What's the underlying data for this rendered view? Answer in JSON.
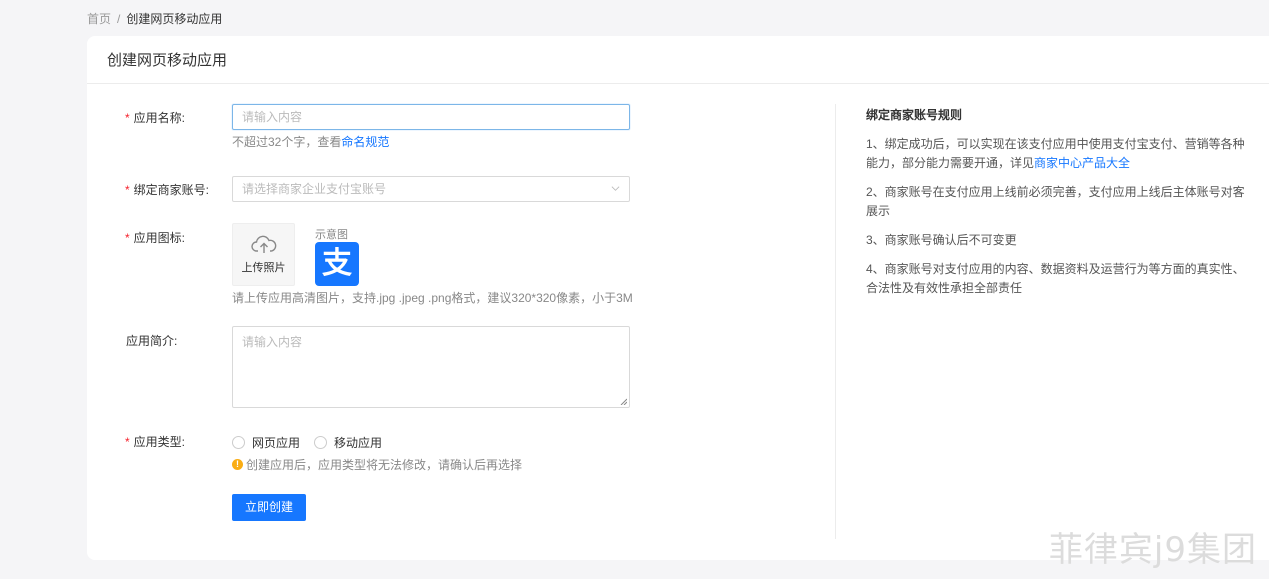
{
  "breadcrumb": {
    "home": "首页",
    "separator": "/",
    "current": "创建网页移动应用"
  },
  "card": {
    "title": "创建网页移动应用"
  },
  "form": {
    "app_name": {
      "label": "应用名称:",
      "placeholder": "请输入内容",
      "help_prefix": "不超过32个字，查看",
      "help_link": "命名规范"
    },
    "merchant": {
      "label": "绑定商家账号:",
      "placeholder": "请选择商家企业支付宝账号"
    },
    "icon": {
      "label": "应用图标:",
      "upload_text": "上传照片",
      "sample_label": "示意图",
      "sample_glyph": "支",
      "help": "请上传应用高清图片，支持.jpg .jpeg .png格式，建议320*320像素，小于3M"
    },
    "intro": {
      "label": "应用简介:",
      "placeholder": "请输入内容"
    },
    "type": {
      "label": "应用类型:",
      "options": [
        "网页应用",
        "移动应用"
      ],
      "warning_icon": "!",
      "warning": "创建应用后，应用类型将无法修改，请确认后再选择"
    },
    "required_mark": "*",
    "submit_label": "立即创建"
  },
  "rules": {
    "title": "绑定商家账号规则",
    "items": [
      {
        "text": "1、绑定成功后，可以实现在该支付应用中使用支付宝支付、营销等各种能力，部分能力需要开通，详见",
        "link": "商家中心产品大全"
      },
      {
        "text": "2、商家账号在支付应用上线前必须完善，支付应用上线后主体账号对客展示"
      },
      {
        "text": "3、商家账号确认后不可变更"
      },
      {
        "text": "4、商家账号对支付应用的内容、数据资料及运营行为等方面的真实性、合法性及有效性承担全部责任"
      }
    ]
  },
  "watermark": "菲律宾j9集团",
  "colors": {
    "primary": "#1677ff",
    "required": "#f5222d",
    "warning": "#faad14"
  }
}
